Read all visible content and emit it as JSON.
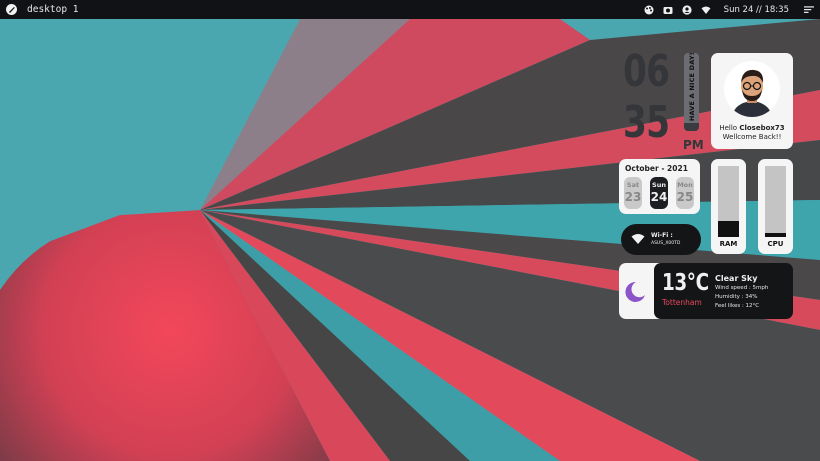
{
  "topbar": {
    "workspace": "desktop 1",
    "datetime": "Sun 24 // 18:35",
    "icons": [
      "app-logo-icon",
      "palette-icon",
      "screenshot-icon",
      "user-icon",
      "wifi-icon",
      "menu-icon"
    ]
  },
  "clock": {
    "hour": "06",
    "minute": "35",
    "ampm": "PM",
    "message": "HAVE A NICE DAY!!"
  },
  "profile": {
    "greeting": "Hello",
    "username": "Closebox73",
    "subtitle": "Wellcome Back!!"
  },
  "calendar": {
    "title": "October - 2021",
    "days": [
      {
        "name": "Sat",
        "date": "23"
      },
      {
        "name": "Sun",
        "date": "24"
      },
      {
        "name": "Mon",
        "date": "25"
      }
    ]
  },
  "wifi": {
    "label": "Wi-Fi :",
    "ssid": "ASUS_X00TD"
  },
  "meters": {
    "ram": {
      "label": "RAM",
      "level": 0.22
    },
    "cpu": {
      "label": "CPU",
      "level": 0.06
    }
  },
  "weather": {
    "temp": "13°C",
    "city": "Tottenham",
    "condition": "Clear Sky",
    "wind": "Wind speed : 5mph",
    "humidity": "Humidity : 34%",
    "feels": "Feel likes : 12°C"
  },
  "colors": {
    "accent_red": "#e94a5e",
    "teal": "#4aa7b0",
    "panel_dark": "#141517",
    "moon": "#8b55c9"
  }
}
